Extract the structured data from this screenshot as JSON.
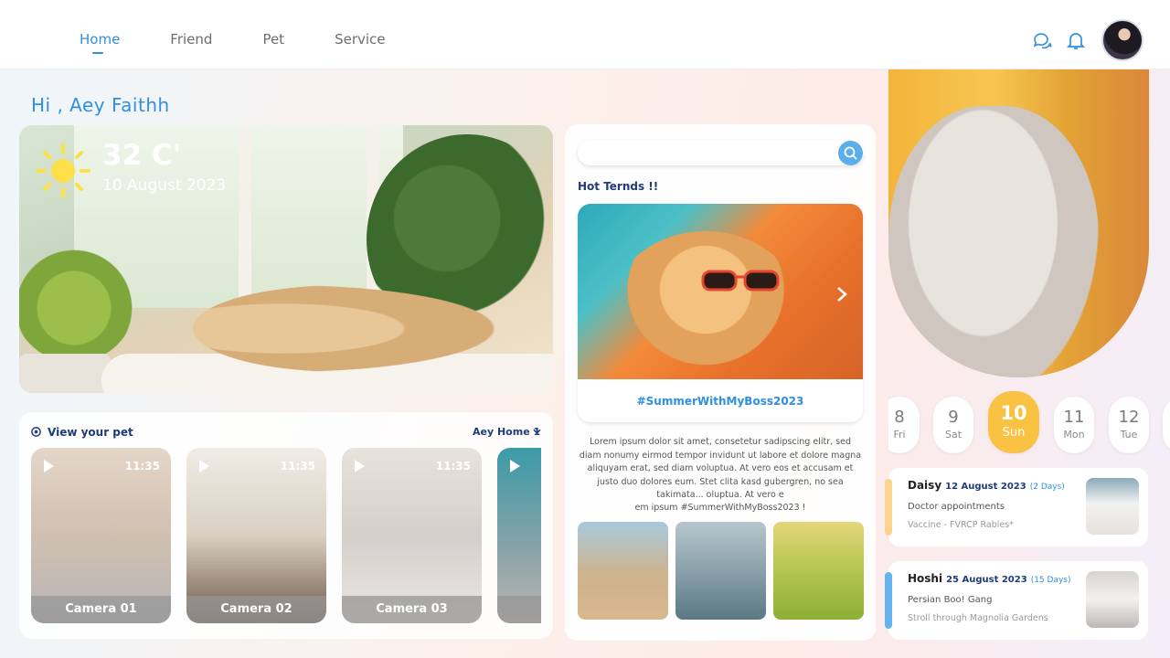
{
  "nav": {
    "items": [
      {
        "label": "Home",
        "active": true
      },
      {
        "label": "Friend",
        "active": false
      },
      {
        "label": "Pet",
        "active": false
      },
      {
        "label": "Service",
        "active": false
      }
    ]
  },
  "header_icons": [
    "chat-icon",
    "bell-icon",
    "avatar"
  ],
  "greeting": "Hi , Aey Faithh",
  "weather": {
    "temperature": "32 C'",
    "date": "10 August 2023",
    "icon": "sun-icon"
  },
  "pets": {
    "title": "View your pet",
    "home_select": "Aey Home 1",
    "cameras": [
      {
        "time": "11:35",
        "label": "Camera 01"
      },
      {
        "time": "11:35",
        "label": "Camera 02"
      },
      {
        "time": "11:35",
        "label": "Camera 03"
      },
      {
        "time": "",
        "label": "C"
      }
    ]
  },
  "trends": {
    "search_placeholder": "",
    "title": "Hot Ternds !!",
    "hashtag": "#SummerWithMyBoss2023",
    "description": "Lorem ipsum dolor sit amet, consetetur sadipscing elitr, sed diam nonumy eirmod tempor invidunt ut labore et dolore magna aliquyam erat, sed diam voluptua. At vero eos et accusam et justo duo dolores eum. Stet clita kasd gubergren, no sea takimata... oluptua. At vero e",
    "description_tail": "em ipsum  #SummerWithMyBoss2023 !"
  },
  "calendar": {
    "days": [
      {
        "num": "8",
        "name": "Fri",
        "active": false
      },
      {
        "num": "9",
        "name": "Sat",
        "active": false
      },
      {
        "num": "10",
        "name": "Sun",
        "active": true
      },
      {
        "num": "11",
        "name": "Mon",
        "active": false
      },
      {
        "num": "12",
        "name": "Tue",
        "active": false
      }
    ]
  },
  "appointments": [
    {
      "name": "Daisy",
      "date": "12 August 2023",
      "days": "(2 Days)",
      "title": "Doctor appointments",
      "sub": "Vaccine - FVRCP Rabies*",
      "color": "#fbd38d"
    },
    {
      "name": "Hoshi",
      "date": "25 August 2023",
      "days": "(15 Days)",
      "title": "Persian Boo! Gang",
      "sub": "Stroll through Magnolia Gardens",
      "color": "#63b3ed"
    }
  ],
  "colors": {
    "accent": "#2f8fe0",
    "navy": "#1f3b78",
    "highlight": "#f9c243"
  }
}
